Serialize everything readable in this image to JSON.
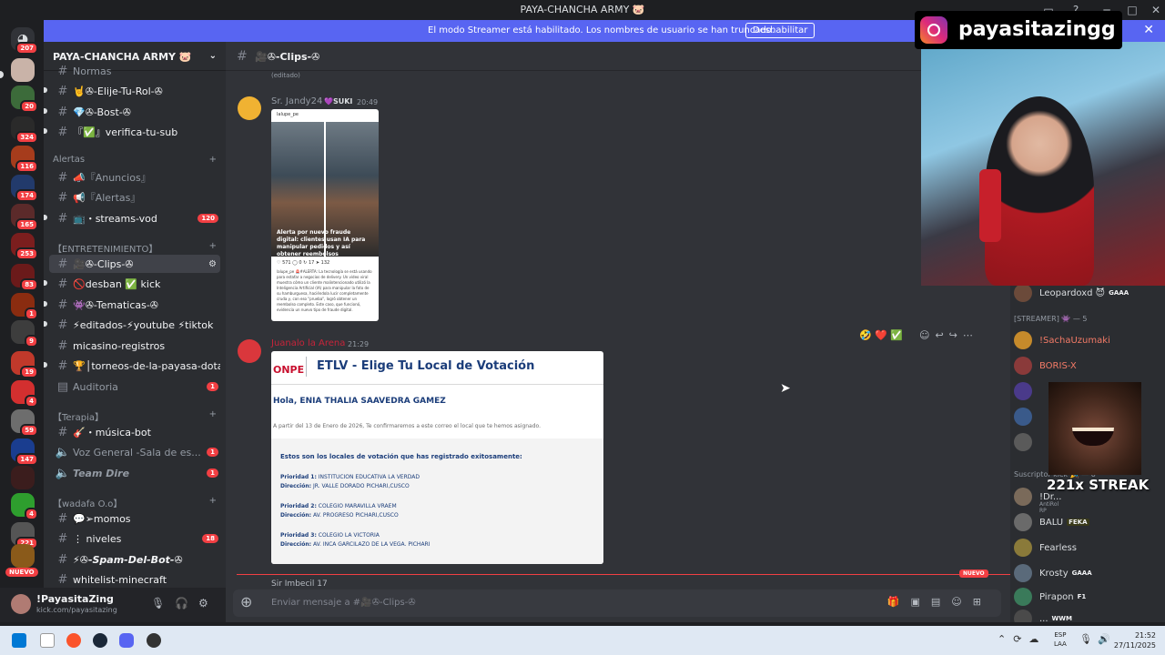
{
  "window": {
    "title": "PAYA-CHANCHA ARMY 🐷"
  },
  "banner": {
    "text": "El modo Streamer está habilitado. Los nombres de usuario se han truncado.",
    "button": "Deshabilitar"
  },
  "server": {
    "name": "PAYA-CHANCHA ARMY 🐷"
  },
  "rail": {
    "badges": [
      "207",
      "20",
      "324",
      "116",
      "174",
      "165",
      "253",
      "83",
      "1",
      "9",
      "19",
      "4",
      "59",
      "147",
      "4",
      "221"
    ],
    "new_label": "NUEVO"
  },
  "channels": [
    {
      "name": "Normas",
      "badge": ""
    },
    {
      "name": "🤘✇-Elije-Tu-Rol-✇",
      "badge": ""
    },
    {
      "name": "💎✇-Bost-✇",
      "badge": ""
    },
    {
      "name": "『✅』verifica-tu-sub",
      "badge": ""
    },
    {
      "name": "📣『Anuncios』",
      "badge": ""
    },
    {
      "name": "📢『Alertas』",
      "badge": ""
    },
    {
      "name": "📺・streams-vod",
      "badge": "120"
    },
    {
      "name": "🎥✇-Clips-✇",
      "badge": ""
    },
    {
      "name": "🚫desban ✅ kick",
      "badge": ""
    },
    {
      "name": "👾✇-Tematicas-✇",
      "badge": ""
    },
    {
      "name": "⚡editados-⚡youtube ⚡tiktok",
      "badge": ""
    },
    {
      "name": "micasino-registros",
      "badge": ""
    },
    {
      "name": "🏆│torneos-de-la-payasa-dota2",
      "badge": ""
    },
    {
      "name": "Auditoria",
      "badge": "1"
    },
    {
      "name": "🎸・música-bot",
      "badge": ""
    },
    {
      "name": "Voz General -Sala de es...",
      "badge": "1"
    },
    {
      "name": "Team Dire",
      "badge": "1"
    },
    {
      "name": "💬➢momos",
      "badge": ""
    },
    {
      "name": "⋮ niveles",
      "badge": "18"
    },
    {
      "name": "⚡✇-Spam-Del-Bot-✇",
      "badge": ""
    },
    {
      "name": "whitelist-minecraft",
      "badge": ""
    }
  ],
  "categories": {
    "alertas": "Alertas",
    "entretenimiento": "【ENTRETENIMIENTO】",
    "terapia": "【Terapia】",
    "wadafa": "【wadafa O.o】"
  },
  "user": {
    "name": "!PayasitaZing",
    "status": "kick.com/payasitazing"
  },
  "chat": {
    "channel": "🎥✇-Clips-✇",
    "edited": "(editado)",
    "msg1": {
      "author": "Sr. Jandy24",
      "tag": "💜SUKI",
      "time": "20:49"
    },
    "post": {
      "handle": "lalupe_pe",
      "caption": "Alerta por nuevo fraude digital: clientes usan IA para manipular pedidos y así obtener reembolsos",
      "stats": "♡ 571   ◯ 0   ↻ 17   ➤ 132",
      "body": "lalupe_pe 🚨#ALERTA: La tecnología se está usando para estafar a negocios de delivery. Un video viral muestra cómo un cliente malintencionado utilizó la Inteligencia Artificial (IA) para manipular la foto de su hamburguesa, haciéndola lucir completamente cruda y, con eso \"prueba\", logró obtener un reembolso completo. Este caso, que funcionó, evidencia un nuevo tipo de fraude digital."
    },
    "msg2": {
      "author": "Juanalo la Arena",
      "time": "21:29"
    },
    "email": {
      "logo": "ONPE",
      "title": "ETLV - Elige Tu Local de Votación",
      "greeting": "Hola,   ENIA THALIA SAAVEDRA GAMEZ",
      "intro": "A partir del 13 de Enero de 2026, Te confirmaremos a este correo el local que te hemos asignado.",
      "box_title": "Estos son los locales de votación que has registrado exitosamente:",
      "priorities": [
        {
          "label": "Prioridad 1:",
          "value": "INSTITUCION EDUCATIVA LA VERDAD",
          "dir_label": "Dirección:",
          "dir": "JR. VALLE DORADO PICHARI,CUSCO"
        },
        {
          "label": "Prioridad 2:",
          "value": "COLEGIO MARAVILLA VRAEM",
          "dir_label": "Dirección:",
          "dir": "AV. PROGRESO PICHARI,CUSCO"
        },
        {
          "label": "Prioridad 3:",
          "value": "COLEGIO LA VICTORIA",
          "dir_label": "Dirección:",
          "dir": "AV. INCA GARCILAZO DE LA VEGA. PICHARI"
        }
      ]
    },
    "new_tag": "NUEVO",
    "next_author": "Sir Imbecil 17",
    "placeholder": "Enviar mensaje a #🎥✇-Clips-✇"
  },
  "members": {
    "top": {
      "name": "Leopardoxd 😈",
      "tag": "GAAA"
    },
    "streamer_cat": "[STREAMER] 👾 — 5",
    "streamers": [
      "!SachaUzumaki",
      "BORIS-X"
    ],
    "sub_cat": "Suscriptor kick 🎉 — 6",
    "list": [
      {
        "name": "!Dr...",
        "tag": "",
        "sub": "AntiRol RP"
      },
      {
        "name": "BALU",
        "tag": "FEKA",
        "sub": ""
      },
      {
        "name": "Fearless",
        "tag": "",
        "sub": ""
      },
      {
        "name": "Krosty",
        "tag": "GAAA",
        "sub": ""
      },
      {
        "name": "Pirapon",
        "tag": "F1",
        "sub": ""
      },
      {
        "name": "...",
        "tag": "WWM",
        "sub": ""
      }
    ]
  },
  "overlay": {
    "instagram": "payasitazingg",
    "streak": "221x STREAK"
  },
  "taskbar": {
    "lang1": "ESP",
    "lang2": "LAA",
    "time": "21:52",
    "date": "27/11/2025"
  }
}
